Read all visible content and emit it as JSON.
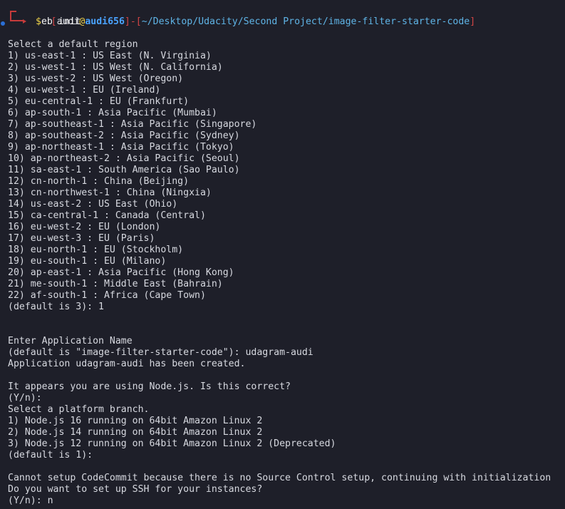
{
  "prompt": {
    "user": "audi",
    "at": "@",
    "host": "audi656",
    "path": "~/Desktop/Udacity/Second Project/image-filter-starter-code",
    "symbol": "$",
    "command": "eb init"
  },
  "colors": {
    "background": "#1e1f29",
    "text": "#d7d9e0",
    "prompt_red": "#d24545",
    "host_blue": "#4aa3ff",
    "at_yellow": "#f0d44a",
    "path_cyan": "#5fb4e6"
  },
  "output_lines": [
    "",
    "Select a default region",
    "1) us-east-1 : US East (N. Virginia)",
    "2) us-west-1 : US West (N. California)",
    "3) us-west-2 : US West (Oregon)",
    "4) eu-west-1 : EU (Ireland)",
    "5) eu-central-1 : EU (Frankfurt)",
    "6) ap-south-1 : Asia Pacific (Mumbai)",
    "7) ap-southeast-1 : Asia Pacific (Singapore)",
    "8) ap-southeast-2 : Asia Pacific (Sydney)",
    "9) ap-northeast-1 : Asia Pacific (Tokyo)",
    "10) ap-northeast-2 : Asia Pacific (Seoul)",
    "11) sa-east-1 : South America (Sao Paulo)",
    "12) cn-north-1 : China (Beijing)",
    "13) cn-northwest-1 : China (Ningxia)",
    "14) us-east-2 : US East (Ohio)",
    "15) ca-central-1 : Canada (Central)",
    "16) eu-west-2 : EU (London)",
    "17) eu-west-3 : EU (Paris)",
    "18) eu-north-1 : EU (Stockholm)",
    "19) eu-south-1 : EU (Milano)",
    "20) ap-east-1 : Asia Pacific (Hong Kong)",
    "21) me-south-1 : Middle East (Bahrain)",
    "22) af-south-1 : Africa (Cape Town)",
    "(default is 3): 1",
    "",
    "",
    "Enter Application Name",
    "(default is \"image-filter-starter-code\"): udagram-audi",
    "Application udagram-audi has been created.",
    "",
    "It appears you are using Node.js. Is this correct?",
    "(Y/n):",
    "Select a platform branch.",
    "1) Node.js 16 running on 64bit Amazon Linux 2",
    "2) Node.js 14 running on 64bit Amazon Linux 2",
    "3) Node.js 12 running on 64bit Amazon Linux 2 (Deprecated)",
    "(default is 1):",
    "",
    "Cannot setup CodeCommit because there is no Source Control setup, continuing with initialization",
    "Do you want to set up SSH for your instances?",
    "(Y/n): n"
  ]
}
